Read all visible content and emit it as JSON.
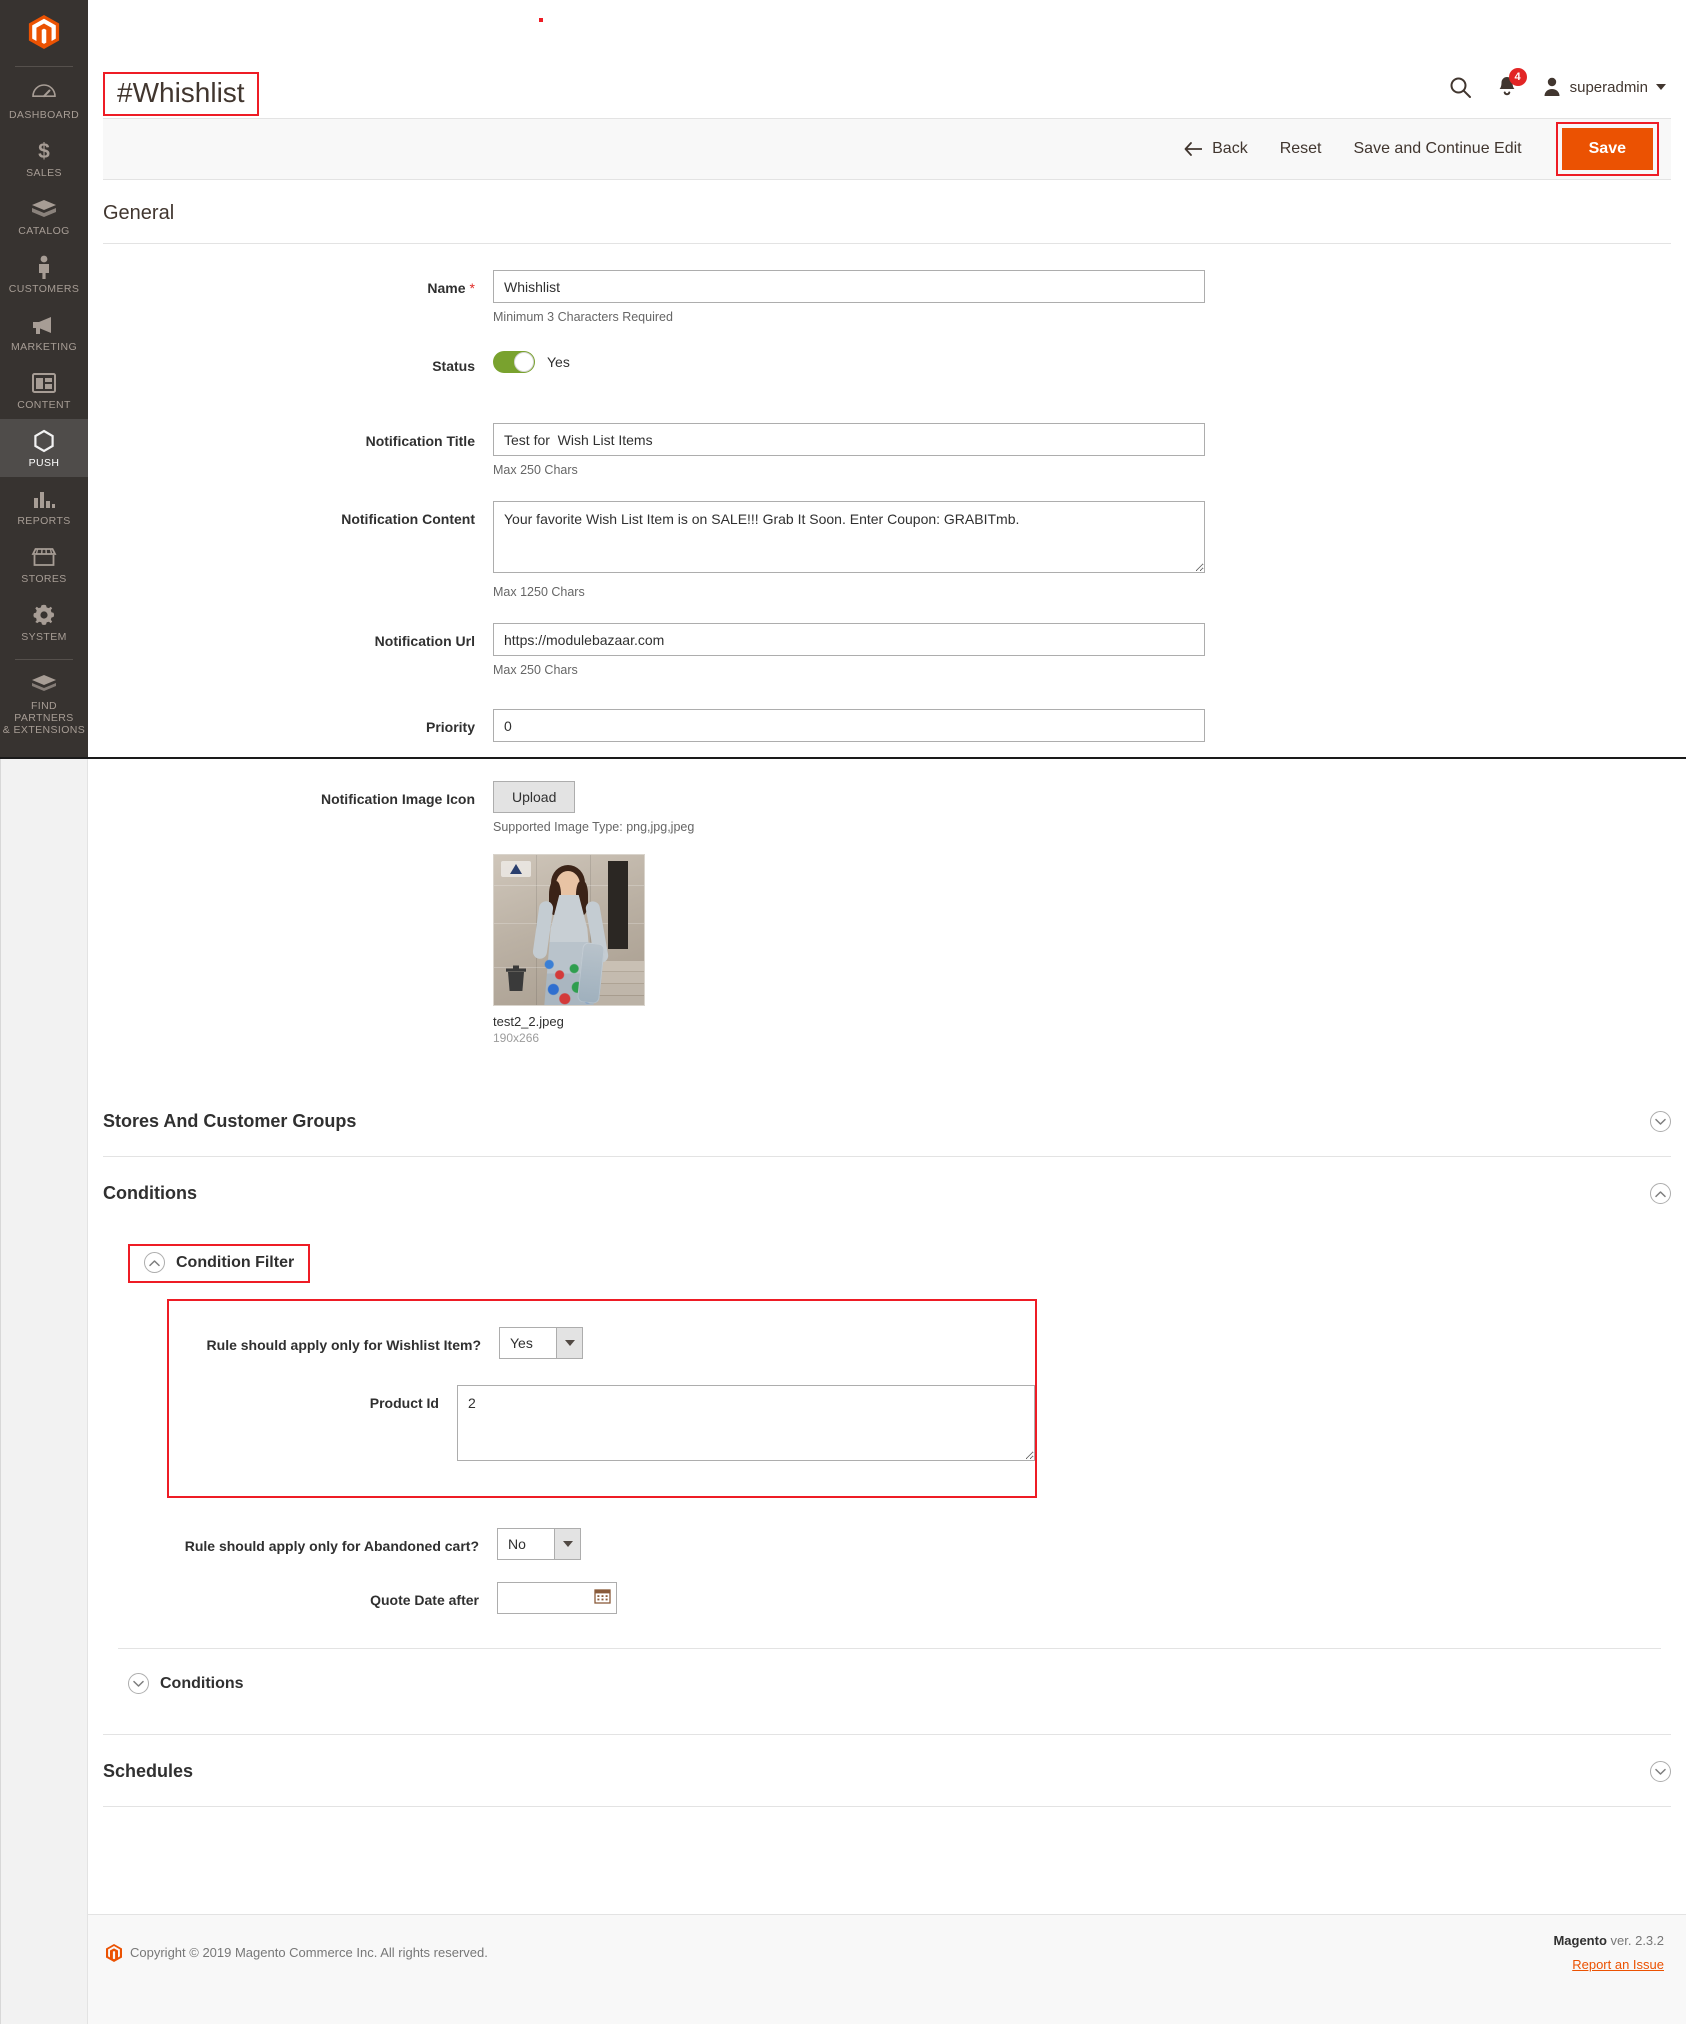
{
  "sidebar": {
    "logo": "magento-logo",
    "items": [
      {
        "label": "DASHBOARD",
        "icon": "dashboard-icon",
        "active": false
      },
      {
        "label": "SALES",
        "icon": "dollar-icon",
        "active": false
      },
      {
        "label": "CATALOG",
        "icon": "box-icon",
        "active": false
      },
      {
        "label": "CUSTOMERS",
        "icon": "person-icon",
        "active": false
      },
      {
        "label": "MARKETING",
        "icon": "megaphone-icon",
        "active": false
      },
      {
        "label": "CONTENT",
        "icon": "layout-icon",
        "active": false
      },
      {
        "label": "PUSH",
        "icon": "hexagon-icon",
        "active": true
      },
      {
        "label": "REPORTS",
        "icon": "bar-chart-icon",
        "active": false
      },
      {
        "label": "STORES",
        "icon": "storefront-icon",
        "active": false
      },
      {
        "label": "SYSTEM",
        "icon": "gear-icon",
        "active": false
      },
      {
        "label": "FIND PARTNERS\n& EXTENSIONS",
        "icon": "partners-icon",
        "active": false
      }
    ],
    "find_partners_line1": "FIND PARTNERS",
    "find_partners_line2": "& EXTENSIONS"
  },
  "header": {
    "page_title": "#Whishlist",
    "search_icon": "search-icon",
    "notifications_icon": "bell-icon",
    "notifications_count": "4",
    "user_icon": "user-icon",
    "user_name": "superadmin"
  },
  "actions": {
    "back": "Back",
    "reset": "Reset",
    "save_and_continue": "Save and Continue Edit",
    "save": "Save"
  },
  "general": {
    "title": "General",
    "name_label": "Name",
    "name_value": "Whishlist",
    "name_hint": "Minimum 3 Characters Required",
    "status_label": "Status",
    "status_value": "Yes",
    "notification_title_label": "Notification Title",
    "notification_title_value": "Test for  Wish List Items",
    "notification_title_hint": "Max 250 Chars",
    "notification_content_label": "Notification Content",
    "notification_content_value": "Your favorite Wish List Item is on SALE!!! Grab It Soon. Enter Coupon: GRABITmb.",
    "notification_content_hint": "Max 1250 Chars",
    "notification_url_label": "Notification Url",
    "notification_url_value": "https://modulebazaar.com",
    "notification_url_hint": "Max 250 Chars",
    "priority_label": "Priority",
    "priority_value": "0",
    "image_icon_label": "Notification Image Icon",
    "upload_button": "Upload",
    "image_hint": "Supported Image Type: png,jpg,jpeg",
    "uploaded_file_name": "test2_2.jpeg",
    "uploaded_file_dimensions": "190x266",
    "delete_icon": "trash-icon"
  },
  "sections": {
    "stores_and_customer_groups": {
      "title": "Stores And Customer Groups",
      "expanded": false,
      "toggle_icon": "chevron-down-icon"
    },
    "conditions": {
      "title": "Conditions",
      "expanded": true,
      "toggle_icon": "chevron-up-icon"
    },
    "schedules": {
      "title": "Schedules",
      "expanded": false,
      "toggle_icon": "chevron-down-icon"
    }
  },
  "condition_filter": {
    "title": "Condition Filter",
    "toggle_icon": "chevron-up-icon",
    "wishlist_rule_label": "Rule should apply only for Wishlist Item?",
    "wishlist_rule_value": "Yes",
    "product_id_label": "Product Id",
    "product_id_value": "2",
    "abandoned_cart_label": "Rule should apply only for Abandoned cart?",
    "abandoned_cart_value": "No",
    "quote_date_label": "Quote Date after",
    "quote_date_value": "",
    "calendar_icon": "calendar-icon"
  },
  "inner_conditions": {
    "title": "Conditions",
    "toggle_icon": "chevron-down-icon"
  },
  "footer": {
    "copyright": "Copyright © 2019 Magento Commerce Inc. All rights reserved.",
    "brand": "Magento",
    "version": " ver. 2.3.2",
    "report_link": "Report an Issue"
  },
  "annotations": {
    "highlight_color": "#ee1c25",
    "highlighted": [
      "page-title",
      "save-button",
      "condition-filter-header",
      "condition-filter-group"
    ]
  }
}
